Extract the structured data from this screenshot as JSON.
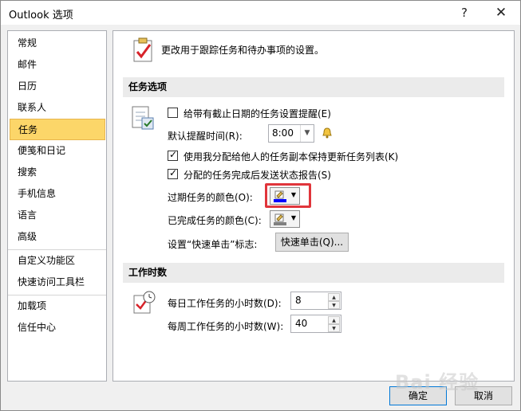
{
  "window": {
    "title": "Outlook 选项",
    "help_label": "?",
    "close_label": "✕"
  },
  "sidebar": {
    "items": [
      {
        "label": "常规"
      },
      {
        "label": "邮件"
      },
      {
        "label": "日历"
      },
      {
        "label": "联系人"
      },
      {
        "label": "任务",
        "active": true
      },
      {
        "label": "便笺和日记"
      },
      {
        "label": "搜索"
      },
      {
        "label": "手机信息"
      },
      {
        "label": "语言"
      },
      {
        "label": "高级"
      },
      {
        "label": "自定义功能区"
      },
      {
        "label": "快速访问工具栏"
      },
      {
        "label": "加载项"
      },
      {
        "label": "信任中心"
      }
    ]
  },
  "header": {
    "description": "更改用于跟踪任务和待办事项的设置。"
  },
  "task_options": {
    "section_title": "任务选项",
    "reminder_checkbox_label": "给带有截止日期的任务设置提醒(E)",
    "reminder_checked": false,
    "default_reminder_time_label": "默认提醒时间(R):",
    "default_reminder_time_value": "8:00",
    "keep_updated_label": "使用我分配给他人的任务副本保持更新任务列表(K)",
    "keep_updated_checked": true,
    "send_status_label": "分配的任务完成后发送状态报告(S)",
    "send_status_checked": true,
    "overdue_color_label": "过期任务的颜色(O):",
    "overdue_color": "#0000ff",
    "completed_color_label": "已完成任务的颜色(C):",
    "completed_color": "#808080",
    "quick_click_label": "设置“快速单击”标志:",
    "quick_click_button": "快速单击(Q)..."
  },
  "work_hours": {
    "section_title": "工作时数",
    "daily_label": "每日工作任务的小时数(D):",
    "daily_value": "8",
    "weekly_label": "每周工作任务的小时数(W):",
    "weekly_value": "40"
  },
  "footer": {
    "ok_label": "确定",
    "cancel_label": "取消"
  },
  "watermark": "Bai 经验",
  "colors": {
    "active_nav": "#fcd669",
    "highlight_border": "#e0353b",
    "section_bg": "#ebebeb"
  }
}
